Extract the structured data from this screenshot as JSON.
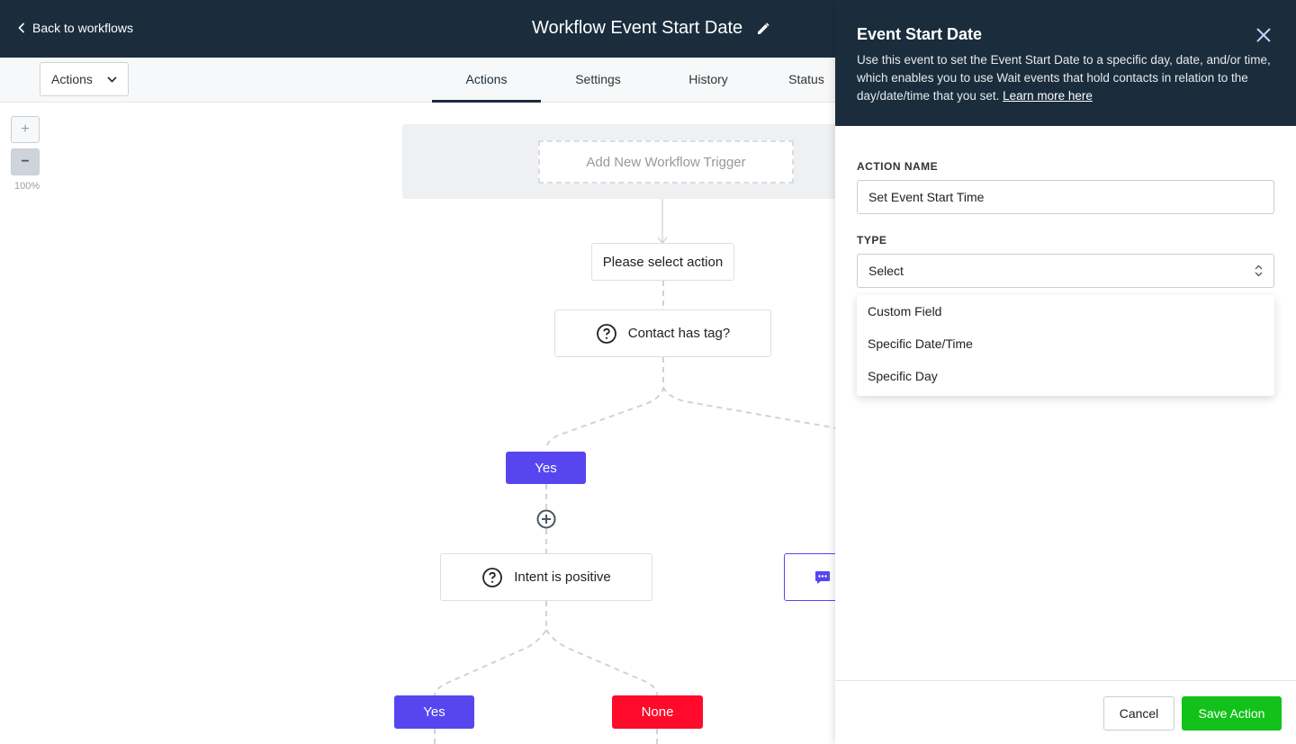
{
  "header": {
    "back_label": "Back to workflows",
    "workflow_title": "Workflow Event Start Date"
  },
  "toolbar": {
    "actions_dropdown": "Actions",
    "tabs": [
      {
        "label": "Actions",
        "active": true
      },
      {
        "label": "Settings",
        "active": false
      },
      {
        "label": "History",
        "active": false
      },
      {
        "label": "Status",
        "active": false
      }
    ]
  },
  "canvas": {
    "zoom_in": "+",
    "zoom_out": "−",
    "zoom_level": "100%",
    "trigger_placeholder": "Add New Workflow Trigger",
    "nodes": {
      "select_action": "Please select action",
      "contact_has_tag": "Contact has tag?",
      "intent_positive": "Intent is positive"
    },
    "branches": {
      "yes_1": "Yes",
      "yes_2": "Yes",
      "none": "None"
    }
  },
  "panel": {
    "title": "Event Start Date",
    "description": "Use this event to set the Event Start Date to a specific day, date, and/or time, which enables you to use Wait events that hold contacts in relation to the day/date/time that you set.",
    "learn_more": "Learn more here",
    "action_name_label": "ACTION NAME",
    "action_name_value": "Set Event Start Time",
    "type_label": "TYPE",
    "type_value": "Select",
    "type_options": [
      "Custom Field",
      "Specific Date/Time",
      "Specific Day"
    ],
    "cancel_label": "Cancel",
    "save_label": "Save Action"
  },
  "colors": {
    "header_bg": "#1b2d3d",
    "yes_branch": "#5746f0",
    "none_branch": "#ff0a2a",
    "save_button": "#12c21a"
  }
}
